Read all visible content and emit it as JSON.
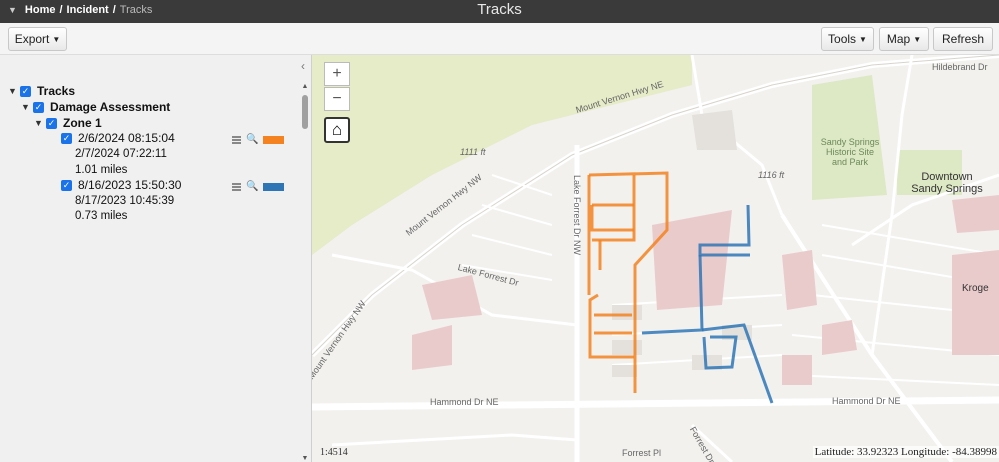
{
  "breadcrumb": {
    "home": "Home",
    "incident": "Incident",
    "tracks": "Tracks",
    "separator": "/"
  },
  "window_title": "Tracks",
  "toolbar": {
    "export_label": "Export",
    "tools_label": "Tools",
    "map_label": "Map",
    "refresh_label": "Refresh"
  },
  "tree": {
    "root": "Tracks",
    "group": "Damage Assessment",
    "zone": "Zone 1",
    "tracks": [
      {
        "start": "2/6/2024 08:15:04",
        "end": "2/7/2024 07:22:11",
        "distance": "1.01 miles",
        "color": "#f58220"
      },
      {
        "start": "8/16/2023 15:50:30",
        "end": "8/17/2023 10:45:39",
        "distance": "0.73 miles",
        "color": "#2e75b6"
      }
    ]
  },
  "map": {
    "labels": {
      "mvh_ne": "Mount Vernon Hwy NE",
      "mvh_nw": "Mount Vernon Hwy NW",
      "mvh_nw2": "Mount Vernon Hwy NW",
      "lake_forrest_dr": "Lake Forrest Dr",
      "lake_forrest_dr_nw": "Lake Forrest Dr NW",
      "hammond_left": "Hammond Dr NE",
      "hammond_right": "Hammond Dr NE",
      "hildebrand": "Hildebrand Dr",
      "elev1": "1111 ft",
      "elev2": "1116 ft",
      "historic": "Sandy Springs Historic Site and Park",
      "downtown": "Downtown Sandy Springs",
      "kroger": "Kroge",
      "forrest_pl": "Forrest Pl",
      "forrest_dr": "Forrest Dr"
    },
    "zoom_in": "+",
    "zoom_out": "−",
    "scale": "1:4514",
    "coordinates": "Latitude: 33.92323 Longitude: -84.38998"
  },
  "colors": {
    "track1": "#f58220",
    "track2": "#2e75b6",
    "checkbox": "#1a73e8"
  },
  "icons": [
    "menu-caret-icon",
    "collapse-chevron-icon",
    "checkbox-icon",
    "details-list-icon",
    "zoom-magnifier-icon",
    "home-icon"
  ]
}
